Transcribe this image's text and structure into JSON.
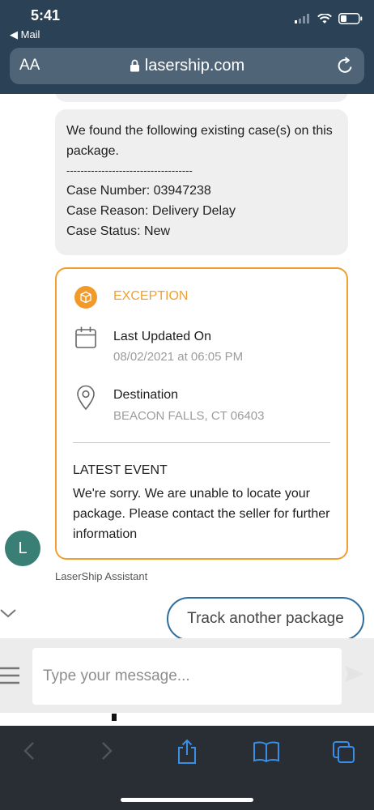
{
  "status_bar": {
    "time": "5:41",
    "back_label": "◀ Mail"
  },
  "url_bar": {
    "aa_label": "AA",
    "domain": "lasership.com"
  },
  "case_bubble": {
    "intro": "We found the following existing case(s) on this package.",
    "separator": "------------------------------------",
    "case_number": "Case Number: 03947238",
    "case_reason": "Case Reason: Delivery Delay",
    "case_status": "Case Status: New"
  },
  "tracking_card": {
    "status_label": "EXCEPTION",
    "last_updated_label": "Last Updated On",
    "last_updated_value": "08/02/2021 at 06:05 PM",
    "destination_label": "Destination",
    "destination_value": "BEACON FALLS, CT 06403",
    "latest_event_title": "LATEST EVENT",
    "latest_event_text": "We're sorry. We are unable to locate your package. Please contact the seller for further information"
  },
  "assistant": {
    "avatar_initial": "L",
    "name": "LaserShip Assistant"
  },
  "quick_reply": {
    "label": "Track another package"
  },
  "composer": {
    "placeholder": "Type your message..."
  },
  "colors": {
    "accent": "#f0a030",
    "button_border": "#2d6e9c",
    "avatar": "#3a7f75",
    "safari_blue": "#3a8ee6"
  }
}
